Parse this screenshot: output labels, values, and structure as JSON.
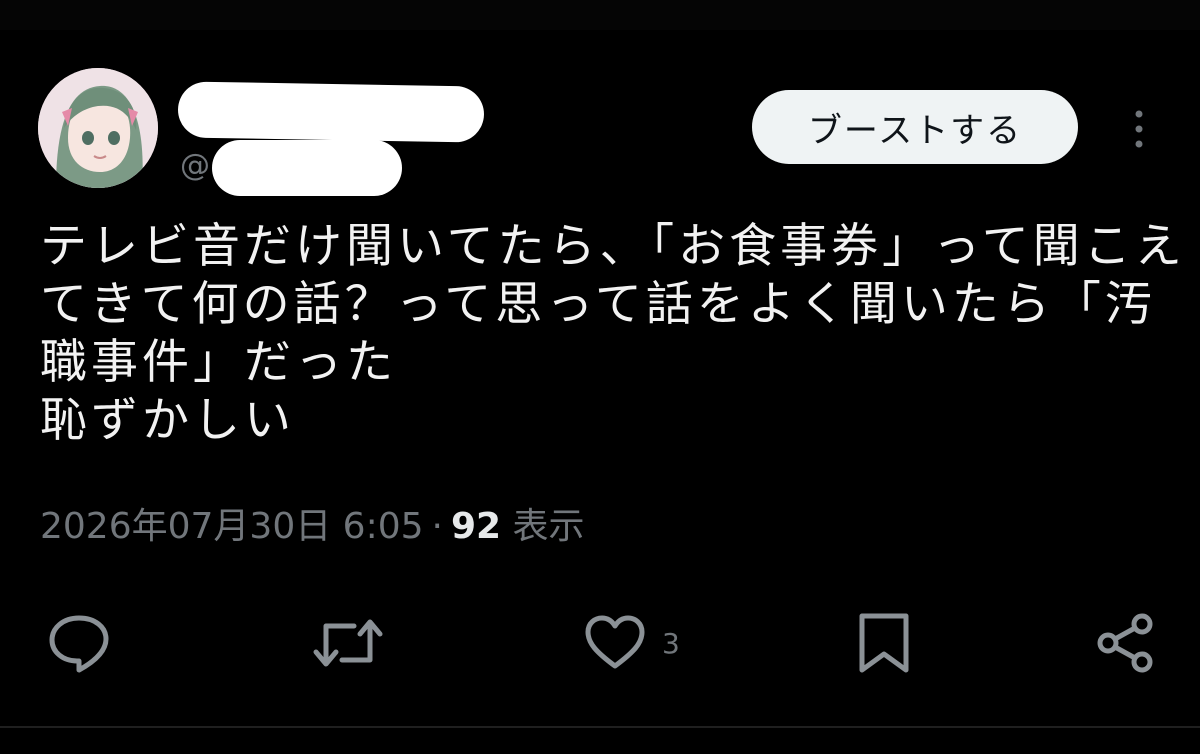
{
  "author": {
    "handle_prefix": "@"
  },
  "header": {
    "boost_label": "ブーストする"
  },
  "post": {
    "lines": [
      "テレビ音だけ聞いてたら、「お食事券」って聞こえ",
      "てきて何の話？って思って話をよく聞いたら「汚",
      "職事件」だった",
      "恥ずかしい"
    ]
  },
  "meta": {
    "timestamp": "2026年07月30日 6:05",
    "separator": "·",
    "views_count": "92",
    "views_label": "表示"
  },
  "actions": {
    "like_count": "3",
    "icons": [
      "reply-icon",
      "repost-icon",
      "like-icon",
      "bookmark-icon",
      "share-icon"
    ]
  },
  "colors": {
    "background": "#000000",
    "text": "#f2f2f2",
    "muted": "#71767b",
    "button_bg": "#eff3f4"
  }
}
